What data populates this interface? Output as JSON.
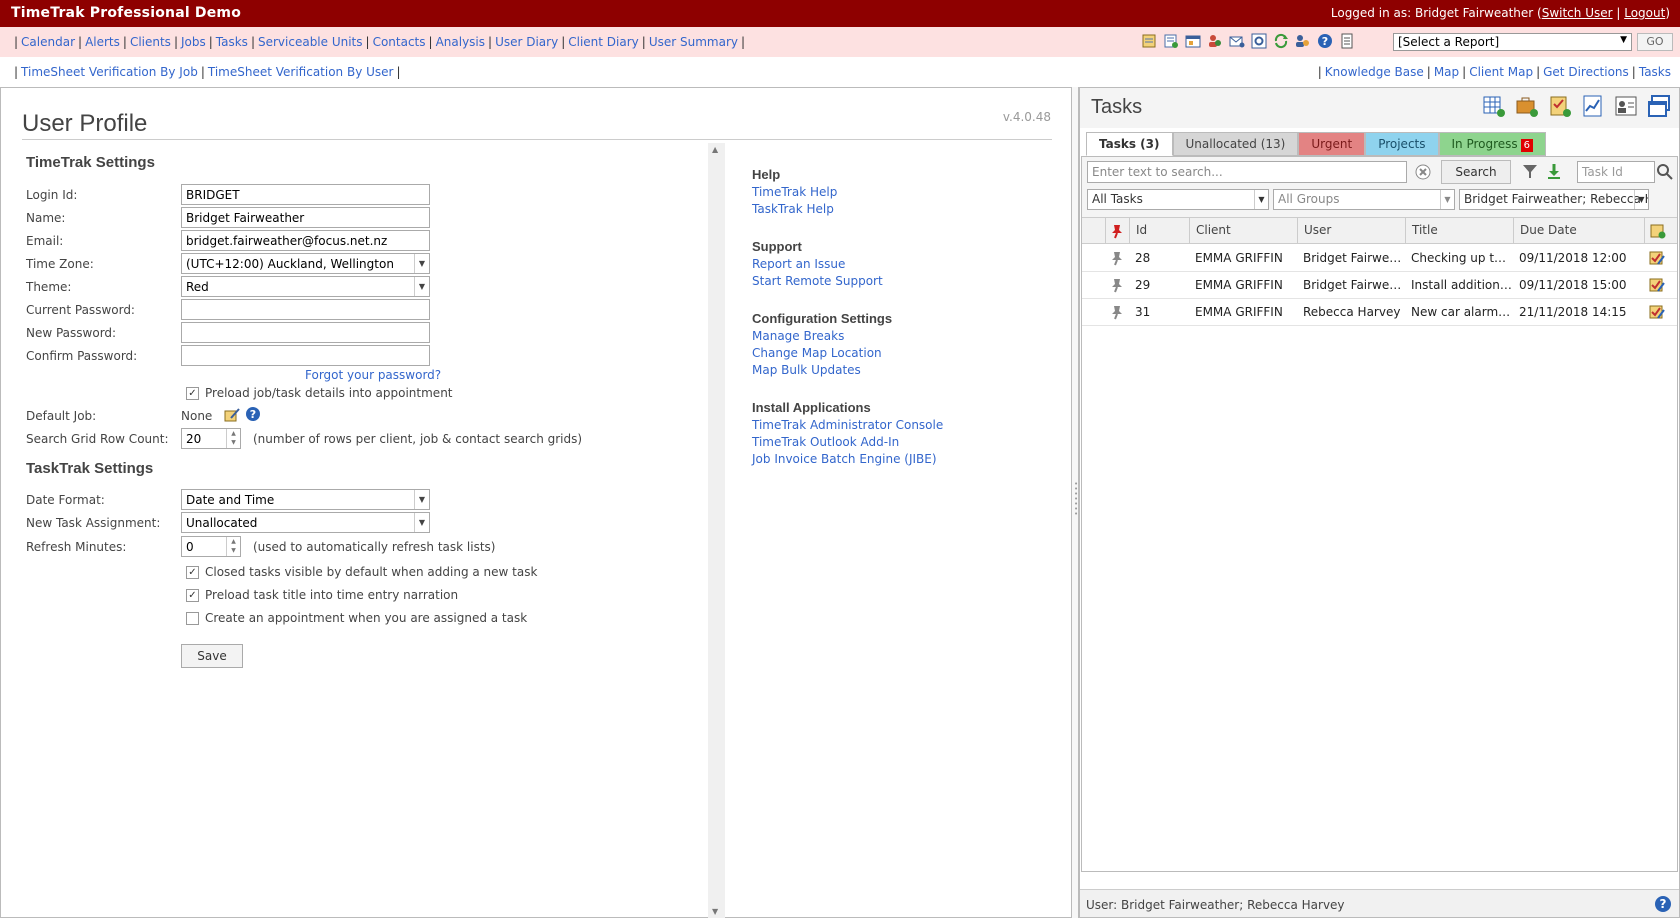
{
  "app": {
    "title": "TimeTrak Professional Demo",
    "logged_in_prefix": "Logged in as: Bridget Fairweather (",
    "switch_user": "Switch User",
    "separator": " | ",
    "logout": "Logout",
    "logged_in_suffix": ")"
  },
  "menu": {
    "items": [
      "Calendar",
      "Alerts",
      "Clients",
      "Jobs",
      "Tasks",
      "Serviceable Units",
      "Contacts",
      "Analysis",
      "User Diary",
      "Client Diary",
      "User Summary"
    ],
    "report_select": "[Select a Report]",
    "go_label": "GO"
  },
  "links2": {
    "left": [
      "TimeSheet Verification By Job",
      "TimeSheet Verification By User"
    ],
    "right": [
      "Knowledge Base",
      "Map",
      "Client Map",
      "Get Directions",
      "Tasks"
    ]
  },
  "profile": {
    "title": "User Profile",
    "version": "v.4.0.48",
    "timetrak_settings": "TimeTrak Settings",
    "fields": {
      "login_id_label": "Login Id:",
      "login_id": "BRIDGET",
      "name_label": "Name:",
      "name": "Bridget Fairweather",
      "email_label": "Email:",
      "email": "bridget.fairweather@focus.net.nz",
      "timezone_label": "Time Zone:",
      "timezone": "(UTC+12:00) Auckland, Wellington",
      "theme_label": "Theme:",
      "theme": "Red",
      "current_password_label": "Current Password:",
      "new_password_label": "New Password:",
      "confirm_password_label": "Confirm Password:"
    },
    "forgot_password": "Forgot your password?",
    "preload_job": "Preload job/task details into appointment",
    "default_job_label": "Default Job:",
    "default_job_value": "None",
    "search_rows_label": "Search Grid Row Count:",
    "search_rows_value": "20",
    "search_rows_hint": "(number of rows per client, job & contact search grids)",
    "tasktrak_settings": "TaskTrak Settings",
    "date_format_label": "Date Format:",
    "date_format": "Date and Time",
    "new_task_label": "New Task Assignment:",
    "new_task": "Unallocated",
    "refresh_label": "Refresh Minutes:",
    "refresh_value": "0",
    "refresh_hint": "(used to automatically refresh task lists)",
    "chk_closed": "Closed tasks visible by default when adding a new task",
    "chk_preload_title": "Preload task title into time entry narration",
    "chk_create_appt": "Create an appointment when you are assigned a task",
    "save_label": "Save"
  },
  "help": {
    "help_title": "Help",
    "help_links": [
      "TimeTrak Help",
      "TaskTrak Help"
    ],
    "support_title": "Support",
    "support_links": [
      "Report an Issue",
      "Start Remote Support"
    ],
    "config_title": "Configuration Settings",
    "config_links": [
      "Manage Breaks",
      "Change Map Location",
      "Map Bulk Updates"
    ],
    "install_title": "Install Applications",
    "install_links": [
      "TimeTrak Administrator Console",
      "TimeTrak Outlook Add-In",
      "Job Invoice Batch Engine (JIBE)"
    ]
  },
  "tasks": {
    "title": "Tasks",
    "tabs": {
      "tasks": "Tasks (3)",
      "unallocated": "Unallocated (13)",
      "urgent": "Urgent",
      "projects": "Projects",
      "in_progress": "In Progress",
      "in_progress_badge": "6"
    },
    "search_placeholder": "Enter text to search...",
    "search_button": "Search",
    "taskid_placeholder": "Task Id",
    "filter_tasks": "All Tasks",
    "filter_groups": "All Groups",
    "filter_users": "Bridget Fairweather; Rebecca Harvey",
    "columns": {
      "id": "Id",
      "client": "Client",
      "user": "User",
      "title": "Title",
      "due": "Due Date"
    },
    "rows": [
      {
        "id": "28",
        "client": "EMMA GRIFFIN",
        "user": "Bridget Fairweather",
        "title": "Checking up the alarm",
        "due": "09/11/2018 12:00"
      },
      {
        "id": "29",
        "client": "EMMA GRIFFIN",
        "user": "Bridget Fairweather",
        "title": "Install additional sensor",
        "due": "09/11/2018 15:00"
      },
      {
        "id": "31",
        "client": "EMMA GRIFFIN",
        "user": "Rebecca Harvey",
        "title": "New car alarm installation",
        "due": "21/11/2018 14:15"
      }
    ],
    "footer": "User: Bridget Fairweather; Rebecca Harvey"
  },
  "colors": {
    "brand": "#8e0000",
    "menu_bg": "#fde1e1",
    "link": "#3366cc"
  }
}
